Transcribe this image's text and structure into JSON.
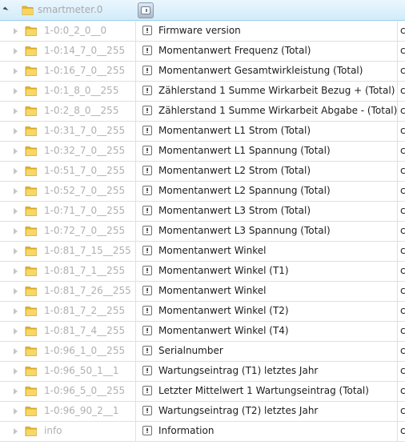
{
  "header": {
    "name": "smartmeter.0",
    "folder_icon": "folder-icon",
    "object_icon": "object-icon"
  },
  "colors": {
    "id_text": "#b0b0b0",
    "label_text": "#1c1c1c",
    "folder": "#f2c94c",
    "header_bg": "#d2ecfa"
  },
  "rows": [
    {
      "id": "1-0:0_2_0__0",
      "name": "Firmware version",
      "col3": "c"
    },
    {
      "id": "1-0:14_7_0__255",
      "name": "Momentanwert Frequenz (Total)",
      "col3": "c"
    },
    {
      "id": "1-0:16_7_0__255",
      "name": "Momentanwert Gesamtwirkleistung (Total)",
      "col3": "c"
    },
    {
      "id": "1-0:1_8_0__255",
      "name": "Zählerstand 1 Summe Wirkarbeit Bezug + (Total)",
      "col3": "c"
    },
    {
      "id": "1-0:2_8_0__255",
      "name": "Zählerstand 1 Summe Wirkarbeit Abgabe - (Total)",
      "col3": "c"
    },
    {
      "id": "1-0:31_7_0__255",
      "name": "Momentanwert L1 Strom (Total)",
      "col3": "c"
    },
    {
      "id": "1-0:32_7_0__255",
      "name": "Momentanwert L1 Spannung (Total)",
      "col3": "c"
    },
    {
      "id": "1-0:51_7_0__255",
      "name": "Momentanwert L2 Strom (Total)",
      "col3": "c"
    },
    {
      "id": "1-0:52_7_0__255",
      "name": "Momentanwert L2 Spannung (Total)",
      "col3": "c"
    },
    {
      "id": "1-0:71_7_0__255",
      "name": "Momentanwert L3 Strom (Total)",
      "col3": "c"
    },
    {
      "id": "1-0:72_7_0__255",
      "name": "Momentanwert L3 Spannung (Total)",
      "col3": "c"
    },
    {
      "id": "1-0:81_7_15__255",
      "name": "Momentanwert Winkel",
      "col3": "c"
    },
    {
      "id": "1-0:81_7_1__255",
      "name": "Momentanwert Winkel (T1)",
      "col3": "c"
    },
    {
      "id": "1-0:81_7_26__255",
      "name": "Momentanwert Winkel",
      "col3": "c"
    },
    {
      "id": "1-0:81_7_2__255",
      "name": "Momentanwert Winkel (T2)",
      "col3": "c"
    },
    {
      "id": "1-0:81_7_4__255",
      "name": "Momentanwert Winkel (T4)",
      "col3": "c"
    },
    {
      "id": "1-0:96_1_0__255",
      "name": "Serialnumber",
      "col3": "c"
    },
    {
      "id": "1-0:96_50_1__1",
      "name": "Wartungseintrag (T1) letztes Jahr",
      "col3": "c"
    },
    {
      "id": "1-0:96_5_0__255",
      "name": "Letzter Mittelwert 1 Wartungseintrag (Total)",
      "col3": "c"
    },
    {
      "id": "1-0:96_90_2__1",
      "name": "Wartungseintrag (T2) letztes Jahr",
      "col3": "c"
    },
    {
      "id": "info",
      "name": "Information",
      "col3": "c"
    }
  ]
}
